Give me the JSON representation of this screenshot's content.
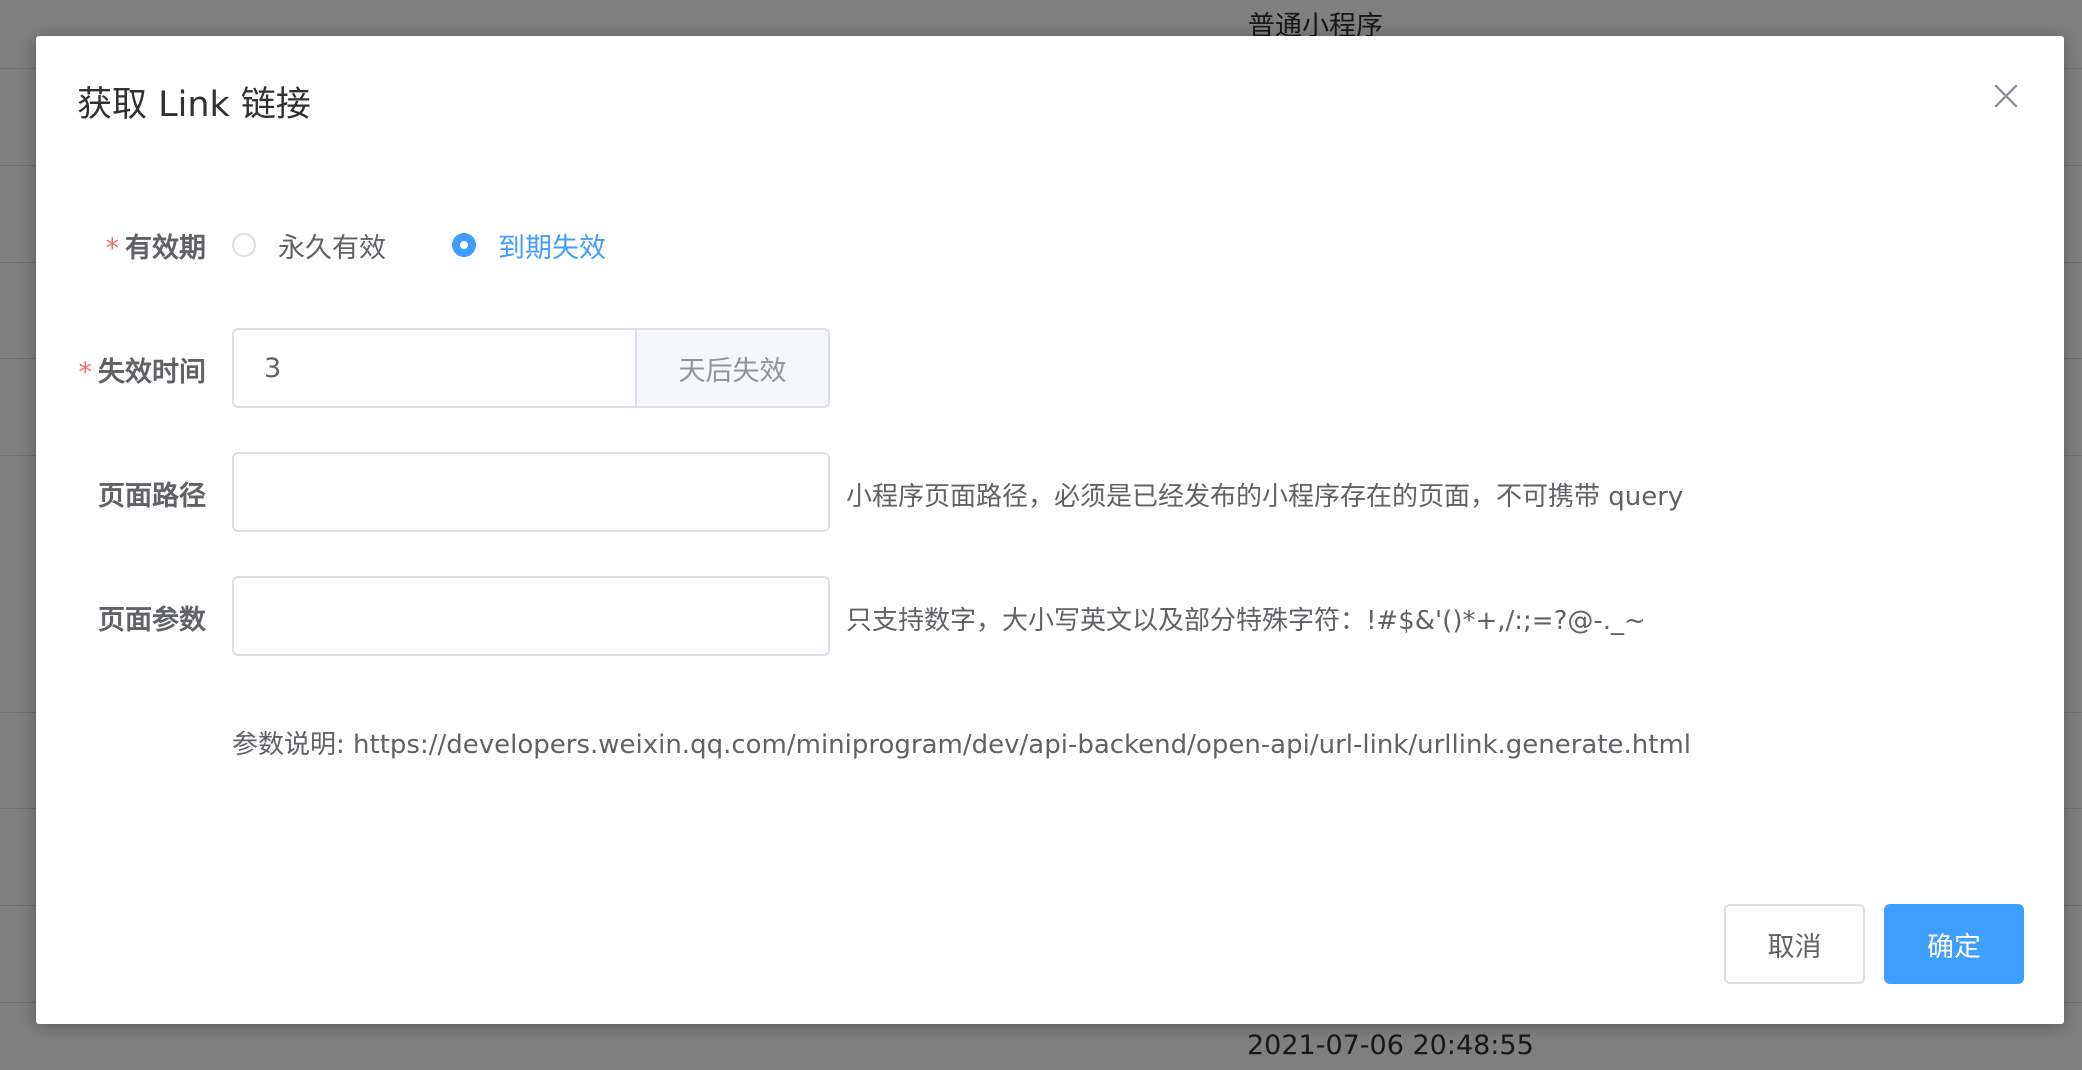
{
  "background": {
    "top_text": "普通小程序",
    "bottom_timestamp": "2021-07-06 20:48:55"
  },
  "dialog": {
    "title": "获取 Link 链接",
    "close_icon": "close-icon",
    "validity": {
      "label": "有效期",
      "required_mark": "*",
      "options": [
        {
          "label": "永久有效",
          "checked": false
        },
        {
          "label": "到期失效",
          "checked": true
        }
      ]
    },
    "expire_time": {
      "label": "失效时间",
      "required_mark": "*",
      "value": "3",
      "suffix": "天后失效"
    },
    "page_path": {
      "label": "页面路径",
      "value": "",
      "hint": "小程序页面路径，必须是已经发布的小程序存在的页面，不可携带 query"
    },
    "page_params": {
      "label": "页面参数",
      "value": "",
      "hint": "只支持数字，大小写英文以及部分特殊字符：!#$&'()*+,/:;=?@-._~"
    },
    "param_note": "参数说明: https://developers.weixin.qq.com/miniprogram/dev/api-backend/open-api/url-link/urllink.generate.html",
    "buttons": {
      "cancel": "取消",
      "confirm": "确定"
    }
  },
  "colors": {
    "primary": "#409eff",
    "required": "#f56c6c",
    "overlay": "rgba(0,0,0,0.5)"
  }
}
